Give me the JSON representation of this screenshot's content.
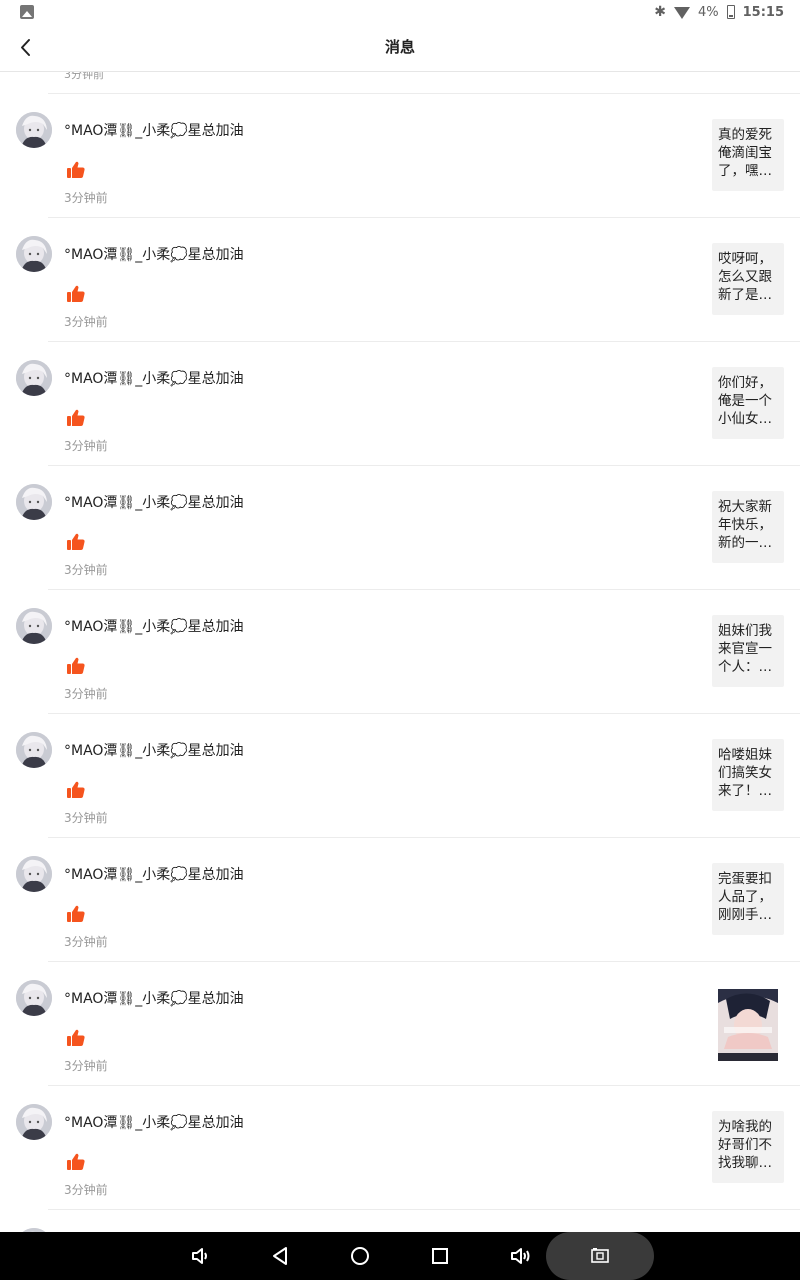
{
  "status_bar": {
    "battery_percent": "4%",
    "time": "15:15",
    "icons": [
      "gallery-icon",
      "bluetooth-icon",
      "wifi-icon",
      "battery-icon"
    ]
  },
  "header": {
    "title": "消息",
    "back_icon": "chevron-left-icon"
  },
  "partial_top_time": "3分钟前",
  "notifications": [
    {
      "name": "°MAO潭⛓_小柔💭星总加油",
      "time": "3分钟前",
      "preview": "真的爱死俺滴闺宝了，嘿…",
      "preview_type": "text"
    },
    {
      "name": "°MAO潭⛓_小柔💭星总加油",
      "time": "3分钟前",
      "preview": "哎呀呵，怎么又跟新了是…",
      "preview_type": "text"
    },
    {
      "name": "°MAO潭⛓_小柔💭星总加油",
      "time": "3分钟前",
      "preview": "你们好，俺是一个小仙女…",
      "preview_type": "text"
    },
    {
      "name": "°MAO潭⛓_小柔💭星总加油",
      "time": "3分钟前",
      "preview": "祝大家新年快乐，新的一…",
      "preview_type": "text"
    },
    {
      "name": "°MAO潭⛓_小柔💭星总加油",
      "time": "3分钟前",
      "preview": "姐妹们我来官宣一个人：…",
      "preview_type": "text"
    },
    {
      "name": "°MAO潭⛓_小柔💭星总加油",
      "time": "3分钟前",
      "preview": "哈喽姐妹们搞笑女来了！…",
      "preview_type": "text"
    },
    {
      "name": "°MAO潭⛓_小柔💭星总加油",
      "time": "3分钟前",
      "preview": "完蛋要扣人品了，刚刚手…",
      "preview_type": "text"
    },
    {
      "name": "°MAO潭⛓_小柔💭星总加油",
      "time": "3分钟前",
      "preview": "",
      "preview_type": "image"
    },
    {
      "name": "°MAO潭⛓_小柔💭星总加油",
      "time": "3分钟前",
      "preview": "为啥我的好哥们不找我聊…",
      "preview_type": "text"
    }
  ],
  "colors": {
    "like_accent": "#f5541e",
    "divider": "#ececec",
    "preview_bg": "#f2f2f2",
    "muted_text": "#999999"
  },
  "nav_bar": {
    "icons": [
      "volume-down-icon",
      "back-triangle-icon",
      "home-circle-icon",
      "recents-square-icon",
      "volume-up-icon",
      "screenshot-icon"
    ]
  }
}
